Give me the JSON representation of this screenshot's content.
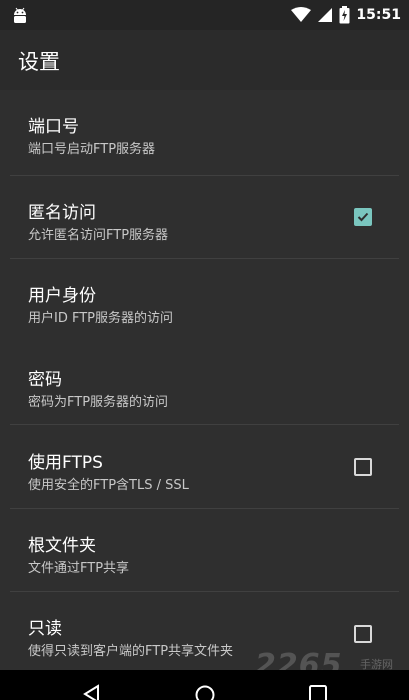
{
  "status_bar": {
    "time": "15:51",
    "icons": [
      "android-icon",
      "wifi-icon",
      "signal-icon",
      "battery-charging-icon"
    ]
  },
  "toolbar": {
    "title": "设置"
  },
  "settings": [
    {
      "title": "端口号",
      "summary": "端口号启动FTP服务器",
      "control": "none"
    },
    {
      "title": "匿名访问",
      "summary": "允许匿名访问FTP服务器",
      "control": "checkbox",
      "checked": true
    },
    {
      "title": "用户身份",
      "summary": "用户ID FTP服务器的访问",
      "control": "none"
    },
    {
      "title": "密码",
      "summary": "密码为FTP服务器的访问",
      "control": "none"
    },
    {
      "title": "使用FTPS",
      "summary": "使用安全的FTP含TLS / SSL",
      "control": "checkbox",
      "checked": false
    },
    {
      "title": "根文件夹",
      "summary": "文件通过FTP共享",
      "control": "none"
    },
    {
      "title": "只读",
      "summary": "使得只读到客户端的FTP共享文件夹",
      "control": "checkbox",
      "checked": false
    }
  ],
  "colors": {
    "accent": "#7ac6bf",
    "background": "#2f2f2f",
    "statusbar": "#252525"
  },
  "watermark": {
    "main": "2265",
    "sub": "手游网"
  }
}
